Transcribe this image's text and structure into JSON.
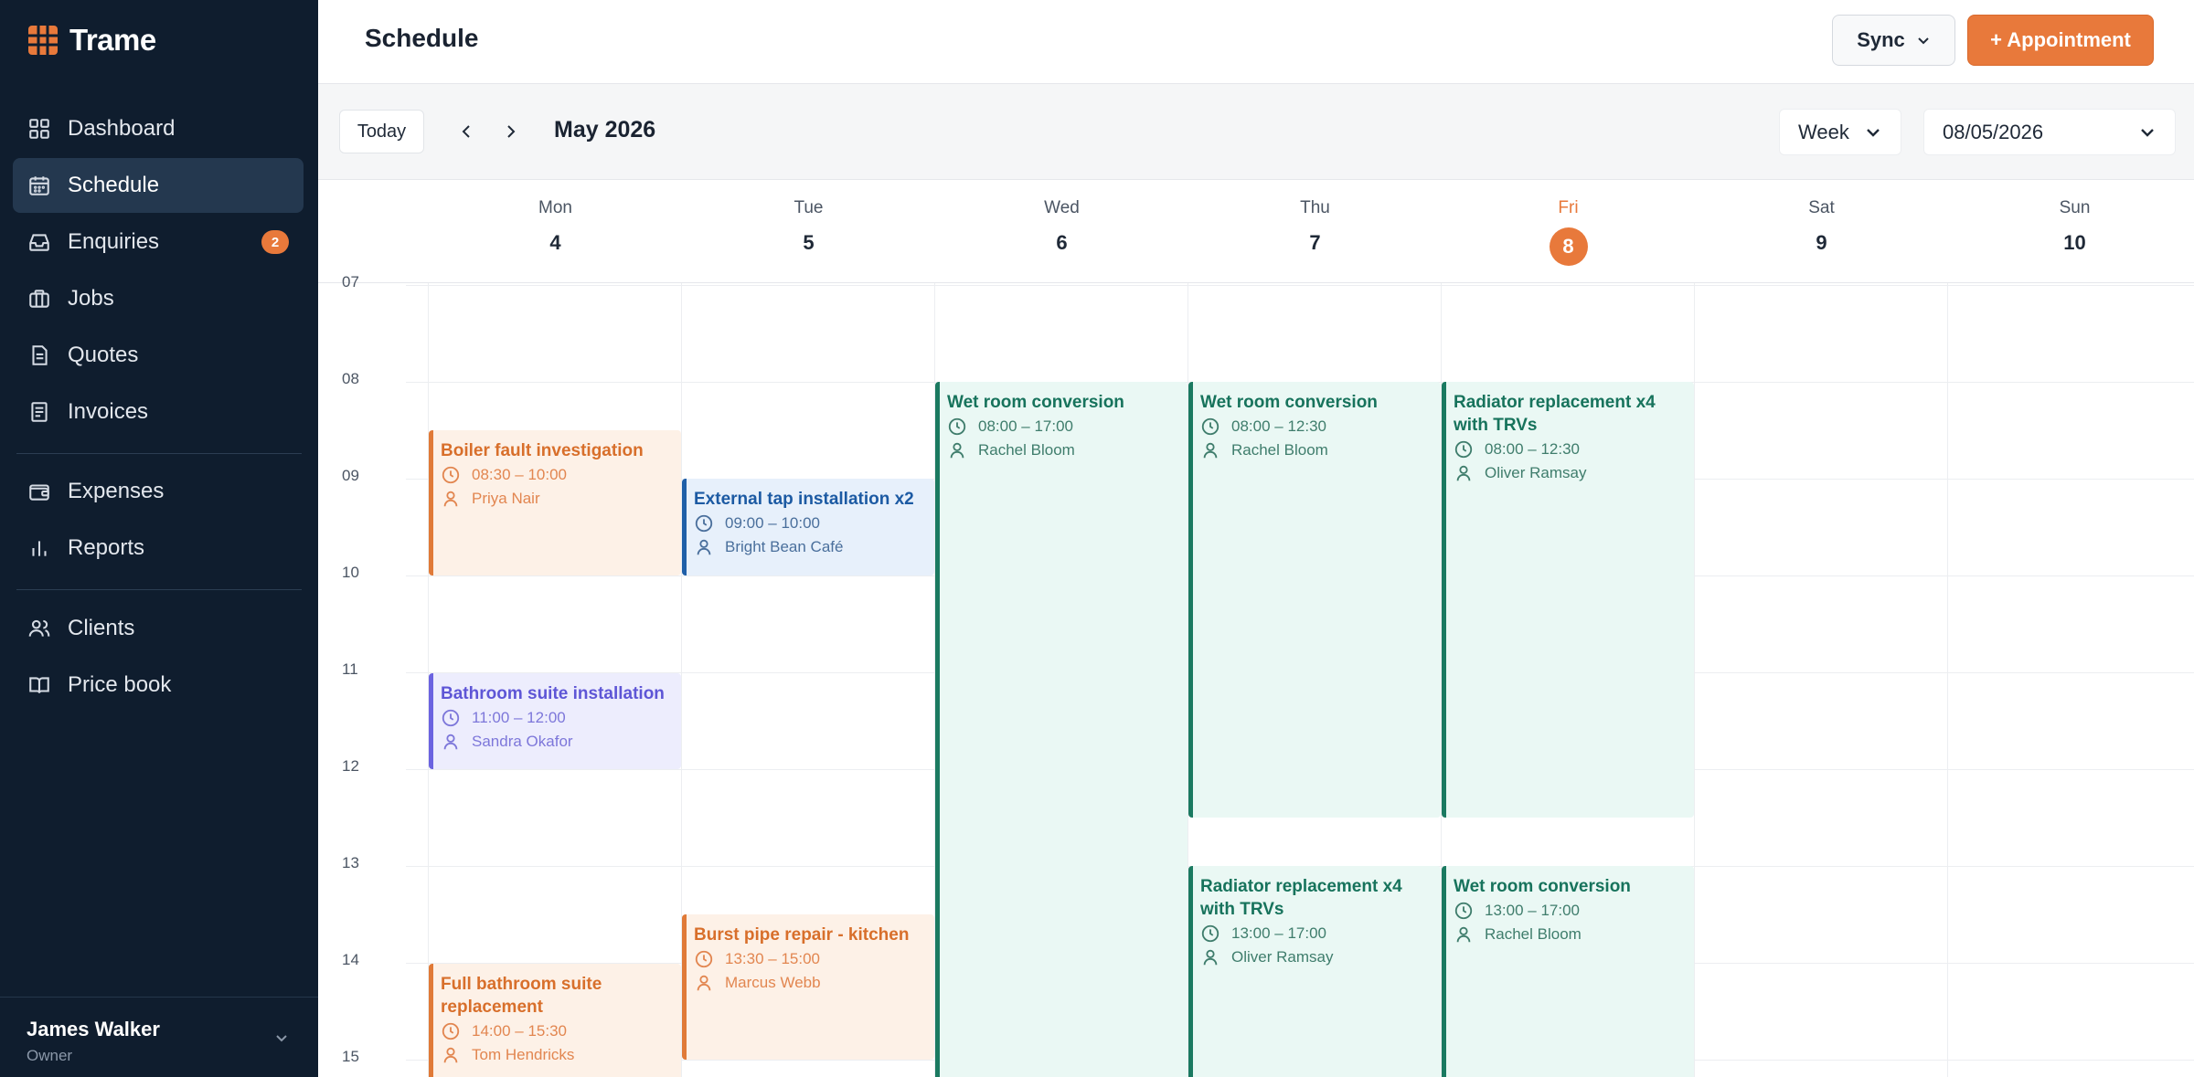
{
  "app": {
    "name": "Trame",
    "logo_icon": "grid-logo-icon",
    "accent": "#e8793b"
  },
  "sidebar": {
    "items": [
      {
        "label": "Dashboard",
        "icon": "dashboard-icon"
      },
      {
        "label": "Schedule",
        "icon": "calendar-icon",
        "active": true
      },
      {
        "label": "Enquiries",
        "icon": "inbox-icon",
        "badge": "2"
      },
      {
        "label": "Jobs",
        "icon": "briefcase-icon"
      },
      {
        "label": "Quotes",
        "icon": "document-icon"
      },
      {
        "label": "Invoices",
        "icon": "receipt-icon"
      },
      {
        "label": "Expenses",
        "icon": "wallet-icon"
      },
      {
        "label": "Reports",
        "icon": "bar-chart-icon"
      },
      {
        "label": "Clients",
        "icon": "users-icon"
      },
      {
        "label": "Price book",
        "icon": "book-icon"
      }
    ],
    "user": {
      "name": "James Walker",
      "role": "Owner"
    }
  },
  "header": {
    "title": "Schedule",
    "sync_label": "Sync",
    "appointment_label": "+ Appointment"
  },
  "toolbar": {
    "today_label": "Today",
    "month": "May 2026",
    "view": "Week",
    "date": "08/05/2026"
  },
  "calendar": {
    "days": [
      {
        "name": "Mon",
        "num": "4"
      },
      {
        "name": "Tue",
        "num": "5"
      },
      {
        "name": "Wed",
        "num": "6"
      },
      {
        "name": "Thu",
        "num": "7"
      },
      {
        "name": "Fri",
        "num": "8",
        "today": true
      },
      {
        "name": "Sat",
        "num": "9"
      },
      {
        "name": "Sun",
        "num": "10"
      }
    ],
    "hours": [
      "07",
      "08",
      "09",
      "10",
      "11",
      "12",
      "13",
      "14",
      "15"
    ],
    "events": [
      {
        "title": "Boiler fault investigation",
        "time": "08:30 – 10:00",
        "person": "Priya Nair",
        "color": "orange"
      },
      {
        "title": "Bathroom suite installation",
        "time": "11:00 – 12:00",
        "person": "Sandra Okafor",
        "color": "purple"
      },
      {
        "title": "Full bathroom suite replacement",
        "time": "14:00 – 15:30",
        "person": "Tom Hendricks",
        "color": "orange"
      },
      {
        "title": "External tap installation x2",
        "time": "09:00 – 10:00",
        "person": "Bright Bean Café",
        "color": "blue"
      },
      {
        "title": "Burst pipe repair - kitchen",
        "time": "13:30 – 15:00",
        "person": "Marcus Webb",
        "color": "orange"
      },
      {
        "title": "Wet room conversion",
        "time": "08:00 – 17:00",
        "person": "Rachel Bloom",
        "color": "green"
      },
      {
        "title": "Wet room conversion",
        "time": "08:00 – 12:30",
        "person": "Rachel Bloom",
        "color": "green"
      },
      {
        "title": "Radiator replacement x4 with TRVs",
        "time": "13:00 – 17:00",
        "person": "Oliver Ramsay",
        "color": "green"
      },
      {
        "title": "Radiator replacement x4 with TRVs",
        "time": "08:00 – 12:30",
        "person": "Oliver Ramsay",
        "color": "green"
      },
      {
        "title": "Wet room conversion",
        "time": "13:00 – 17:00",
        "person": "Rachel Bloom",
        "color": "green"
      }
    ]
  }
}
